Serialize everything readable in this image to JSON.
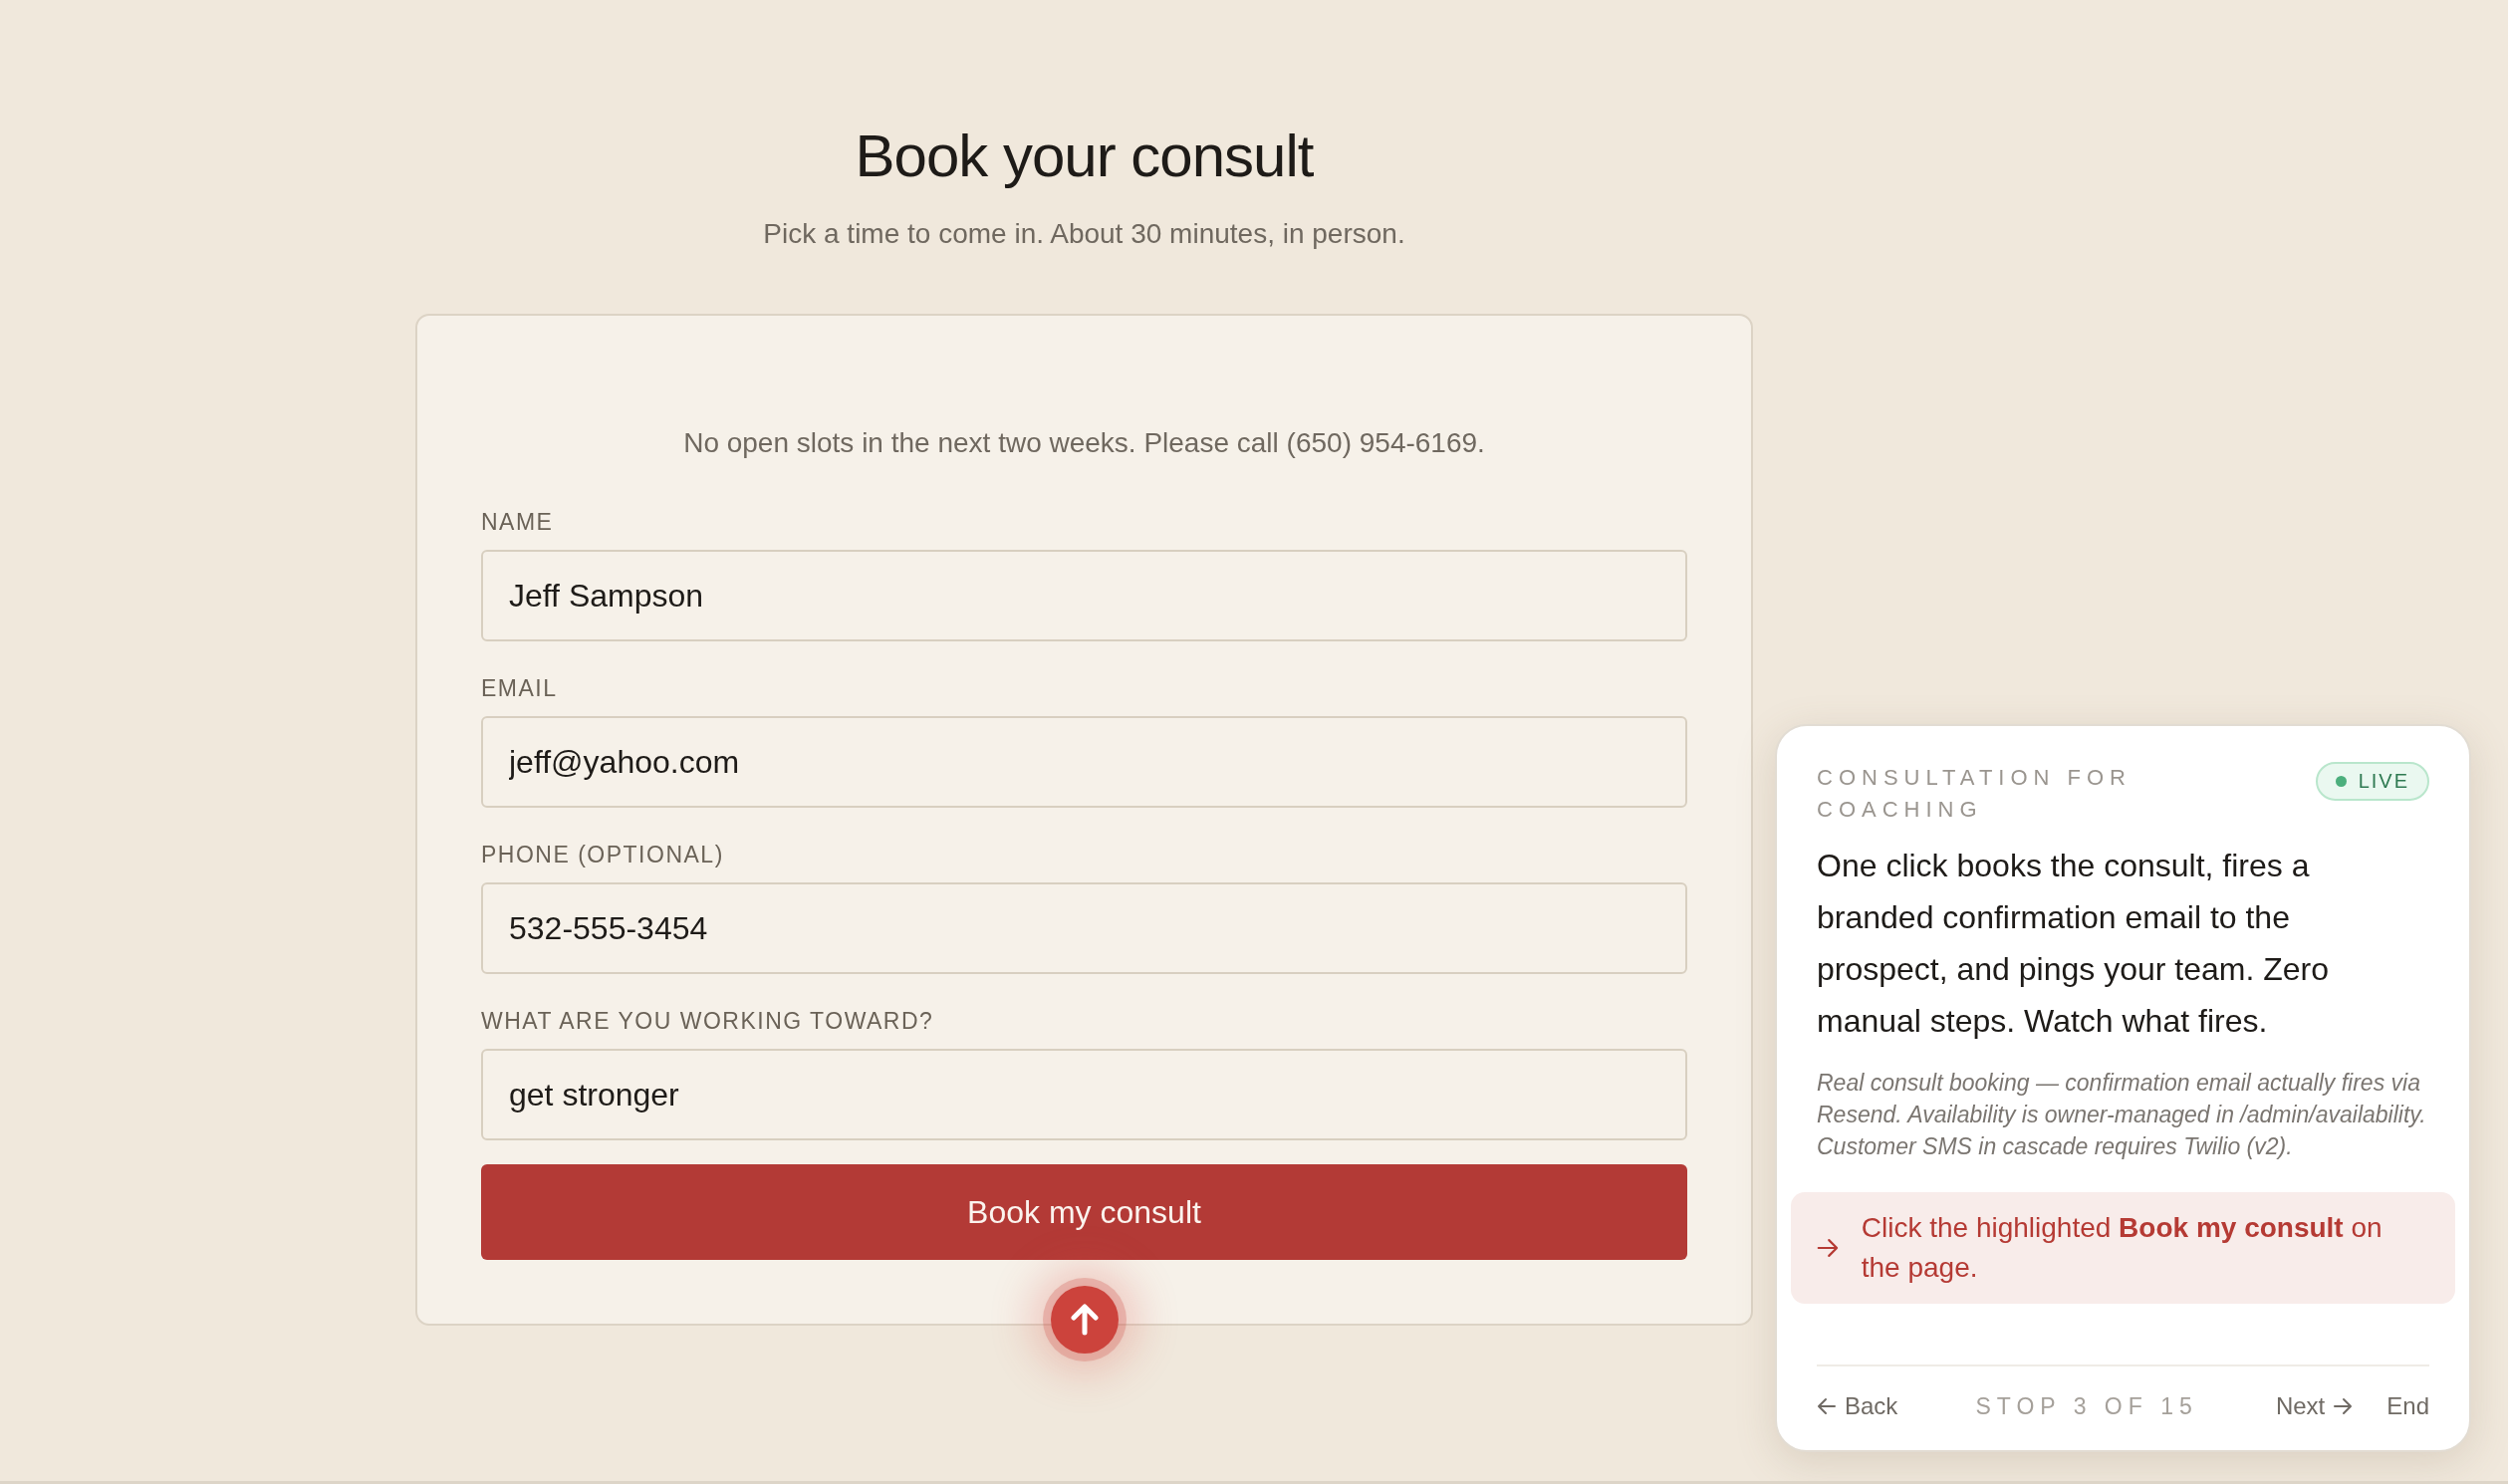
{
  "page": {
    "title": "Book your consult",
    "subtitle": "Pick a time to come in. About 30 minutes, in person."
  },
  "form": {
    "notice": "No open slots in the next two weeks. Please call (650) 954-6169.",
    "fields": [
      {
        "label": "NAME",
        "value": "Jeff Sampson"
      },
      {
        "label": "EMAIL",
        "value": "jeff@yahoo.com"
      },
      {
        "label": "PHONE (OPTIONAL)",
        "value": "532-555-3454"
      },
      {
        "label": "WHAT ARE YOU WORKING TOWARD?",
        "value": "get stronger"
      }
    ],
    "submit": {
      "label": "Book my consult",
      "highlighted": true
    }
  },
  "tour": {
    "eyebrow": "CONSULTATION FOR COACHING",
    "status": "LIVE",
    "body": "One click books the consult, fires a branded confirmation email to the prospect, and pings your team. Zero manual steps. Watch what fires.",
    "note": "Real consult booking — confirmation email actually fires via Resend. Availability is owner-managed in /admin/availability. Customer SMS in cascade requires Twilio (v2).",
    "instruction": "Click the highlighted **Book my consult** on the page.",
    "back": "Back",
    "progress": "STOP 3 OF 15",
    "next": "Next",
    "end": "End"
  }
}
